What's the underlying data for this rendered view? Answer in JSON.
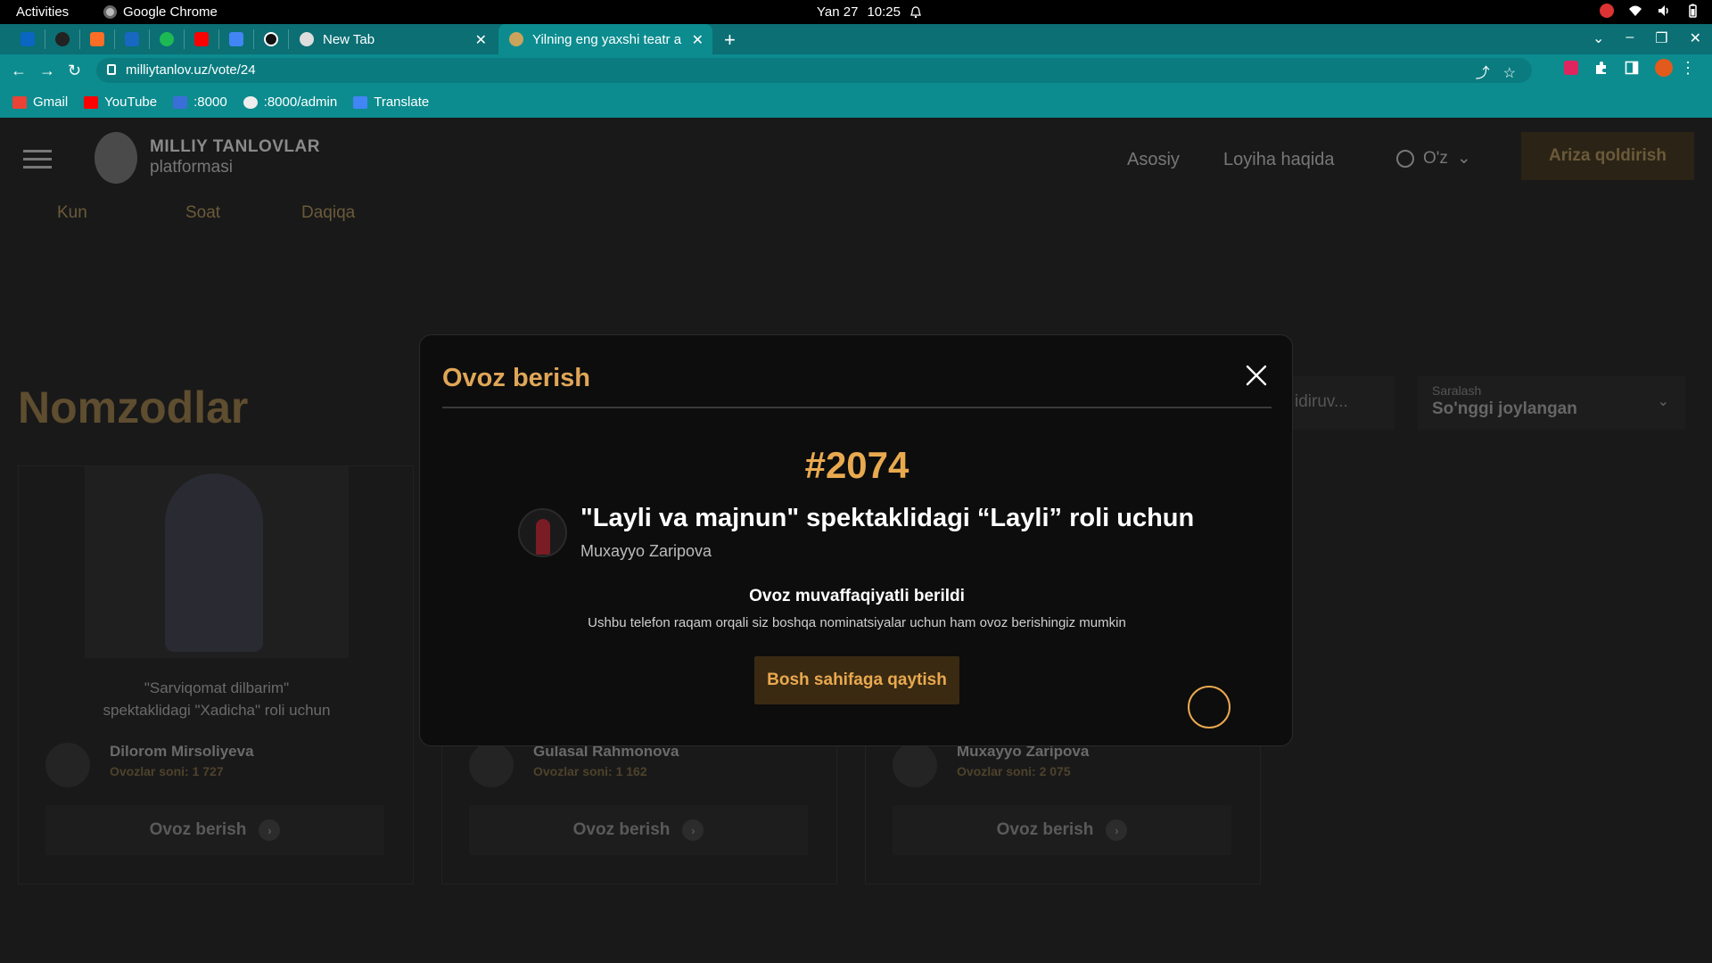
{
  "os": {
    "activities": "Activities",
    "app_name": "Google Chrome",
    "date": "Yan 27",
    "time": "10:25"
  },
  "browser": {
    "tabs": [
      {
        "label": "New Tab"
      },
      {
        "label": "Yilning eng yaxshi teatr a"
      }
    ],
    "url": "milliytanlov.uz/vote/24",
    "bookmarks": [
      {
        "label": "Gmail"
      },
      {
        "label": "YouTube"
      },
      {
        "label": ":8000"
      },
      {
        "label": ":8000/admin"
      },
      {
        "label": "Translate"
      }
    ],
    "colors": {
      "chrome": "#0c8c8f",
      "tabstrip": "#0b6f74"
    }
  },
  "site": {
    "brand_line1": "MILLIY TANLOVLAR",
    "brand_line2": "platformasi",
    "nav": [
      "Asosiy",
      "Loyiha haqida"
    ],
    "language": "O'z",
    "apply_button": "Ariza qoldirish",
    "timer": {
      "days": "Kun",
      "hours": "Soat",
      "minutes": "Daqiqa"
    },
    "heading": "Nomzodlar",
    "search_placeholder": "idiruv...",
    "sort": {
      "label": "Saralash",
      "value": "So'nggi joylangan"
    },
    "candidates": [
      {
        "desc_line1": "\"Sarviqomat dilbarim\"",
        "desc_line2": "spektaklidagi \"Xadicha\" roli uchun",
        "name": "Dilorom Mirsoliyeva",
        "votes": "Ovozlar soni: 1 727",
        "button": "Ovoz berish"
      },
      {
        "desc_line1": "",
        "desc_line2": "",
        "name": "Gulasal Rahmonova",
        "votes": "Ovozlar soni: 1 162",
        "button": "Ovoz berish"
      },
      {
        "desc_line1": "",
        "desc_line2": "",
        "name": "Muxayyo Zaripova",
        "votes": "Ovozlar soni: 2 075",
        "button": "Ovoz berish"
      }
    ]
  },
  "modal": {
    "title": "Ovoz berish",
    "number": "#2074",
    "nomination": "\"Layli va majnun\" spektaklidagi “Layli” roli uchun",
    "candidate_name": "Muxayyo Zaripova",
    "success_title": "Ovoz muvaffaqiyatli berildi",
    "success_hint": "Ushbu telefon raqam orqali siz boshqa nominatsiyalar uchun ham ovoz berishingiz mumkin",
    "home_button": "Bosh sahifaga qaytish",
    "accent_color": "#e9a94f"
  }
}
